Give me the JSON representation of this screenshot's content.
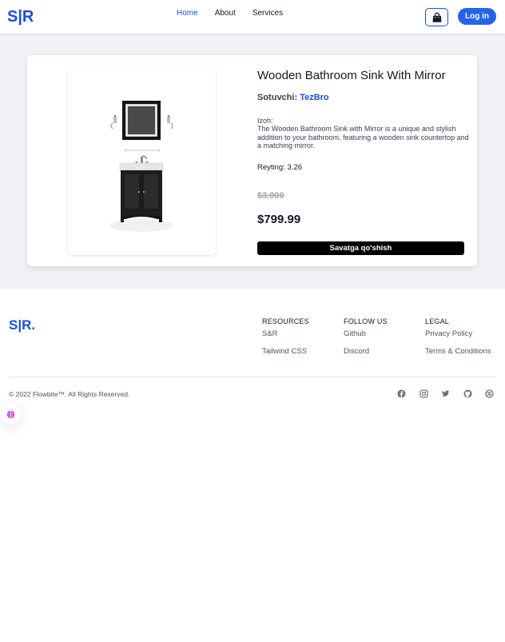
{
  "nav": {
    "logo": "S|R",
    "links": [
      "Home",
      "About",
      "Services"
    ],
    "active_link": "Home",
    "cart_icon": "shopping-bag-icon",
    "login_label": "Log in"
  },
  "product": {
    "title": "Wooden Bathroom Sink With Mirror",
    "seller_label": "Sotuvchi:",
    "seller_name": "TezBro",
    "description_label": "Izoh:",
    "description": "The Wooden Bathroom Sink with Mirror is a unique and stylish addition to your bathroom, featuring a wooden sink countertop and a matching mirror.",
    "rating_label": "Reyting:",
    "rating_value": "3.26",
    "old_price": "$3.000",
    "price": "$799.99",
    "add_to_cart_label": "Savatga qo'shish"
  },
  "footer": {
    "logo": "S|R.",
    "columns": [
      {
        "title": "RESOURCES",
        "links": [
          "S&R",
          "Tailwind CSS"
        ]
      },
      {
        "title": "FOLLOW US",
        "links": [
          "Github",
          "Discord"
        ]
      },
      {
        "title": "LEGAL",
        "links": [
          "Privacy Policy",
          "Terms & Conditions"
        ]
      }
    ],
    "copyright": "© 2022 Flowbite™. All Rights Reserved.",
    "social_icons": [
      "facebook-icon",
      "instagram-icon",
      "twitter-icon",
      "github-icon",
      "dribbble-icon"
    ]
  },
  "colors": {
    "brand": "#1d4ed8",
    "button": "#2563eb",
    "background": "#f1f2f5"
  }
}
